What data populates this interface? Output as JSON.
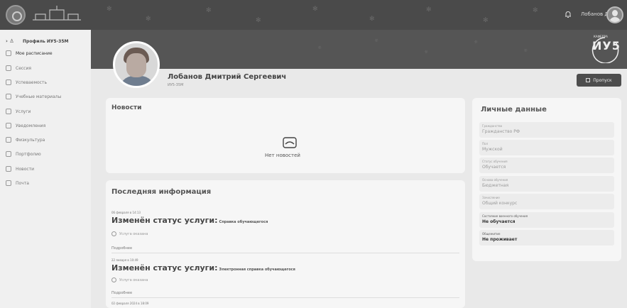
{
  "header": {
    "user_name": "Лобанов Д. С.",
    "icons": [
      "university-emblem-icon",
      "university-building-logo",
      "bell-icon",
      "user-avatar"
    ]
  },
  "sidebar": {
    "items": [
      {
        "label": "Профиль ИУ5-35М",
        "icon": "user-icon"
      },
      {
        "label": "Мое расписание",
        "icon": "calendar-icon"
      },
      {
        "label": "Сессия",
        "icon": "session-icon"
      },
      {
        "label": "Успеваемость",
        "icon": "progress-icon"
      },
      {
        "label": "Учебные материалы",
        "icon": "book-icon"
      },
      {
        "label": "Услуги",
        "icon": "services-icon"
      },
      {
        "label": "Уведомления",
        "icon": "bell-icon"
      },
      {
        "label": "Физкультура",
        "icon": "heart-icon"
      },
      {
        "label": "Портфолио",
        "icon": "portfolio-icon"
      },
      {
        "label": "Новости",
        "icon": "news-icon"
      },
      {
        "label": "Почта",
        "icon": "mail-icon"
      }
    ]
  },
  "profile": {
    "name": "Лобанов Дмитрий Сергеевич",
    "group": "ИУ5-35М",
    "badge_small": "КАФЕДРА",
    "badge_big": "ИУ5",
    "pass_button": "Пропуск"
  },
  "news": {
    "title": "Новости",
    "empty_text": "Нет новостей"
  },
  "latest": {
    "title": "Последняя информация",
    "events": [
      {
        "date": "06 февраля в 14:13",
        "title": "Изменён статус услуги:",
        "desc": "Справка обучающегося",
        "status": "Услуга оказана",
        "more": "Подробнее"
      },
      {
        "date": "22 января в 10:49",
        "title": "Изменён статус услуги:",
        "desc": "Электронная справка обучающегося",
        "status": "Услуга оказана",
        "more": "Подробнее"
      },
      {
        "date": "02 февраля 2024 в 18:09"
      }
    ]
  },
  "personal": {
    "title": "Личные данные",
    "fields": [
      {
        "label": "Гражданство",
        "value": "Гражданство РФ"
      },
      {
        "label": "Пол",
        "value": "Мужской"
      },
      {
        "label": "Статус обучения",
        "value": "Обучается"
      },
      {
        "label": "Основа обучения",
        "value": "Бюджетная"
      },
      {
        "label": "Зачисление",
        "value": "Общий конкурс"
      },
      {
        "label": "Состояние военного обучения",
        "value": "Не обучается"
      },
      {
        "label": "Общежитие",
        "value": "Не проживает"
      }
    ]
  }
}
